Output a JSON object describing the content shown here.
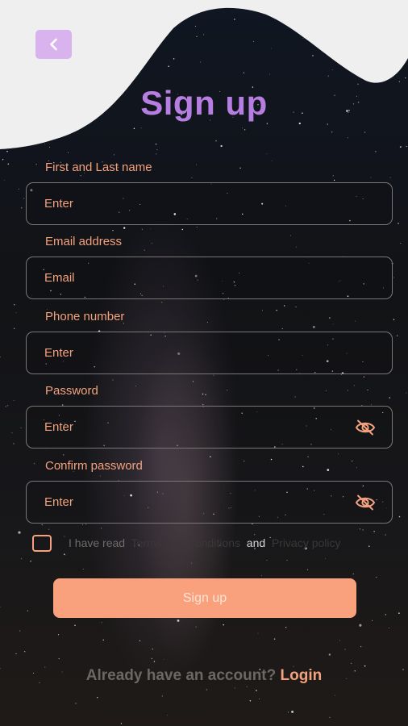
{
  "header": {
    "title": "Sign up"
  },
  "form": {
    "fields": [
      {
        "label": "First and Last name",
        "placeholder": "Enter"
      },
      {
        "label": "Email address",
        "placeholder": "Email"
      },
      {
        "label": "Phone number",
        "placeholder": "Enter"
      },
      {
        "label": "Password",
        "placeholder": "Enter"
      },
      {
        "label": "Confirm password",
        "placeholder": "Enter"
      }
    ],
    "terms": {
      "prefix": "I have read",
      "terms_link": "Terms and Conditions",
      "and": "and",
      "privacy_link": "Privacy policy"
    },
    "submit_label": "Sign up"
  },
  "footer": {
    "prompt": "Already have an account?",
    "login_label": "Login"
  },
  "colors": {
    "accent": "#f4a27e",
    "button": "#f9a07d",
    "title": "#b67ee0",
    "back_button": "#d9b3ee",
    "wave": "#efefef"
  },
  "icons": {
    "back": "chevron-left-icon",
    "password_visibility": "eye-off-icon"
  }
}
